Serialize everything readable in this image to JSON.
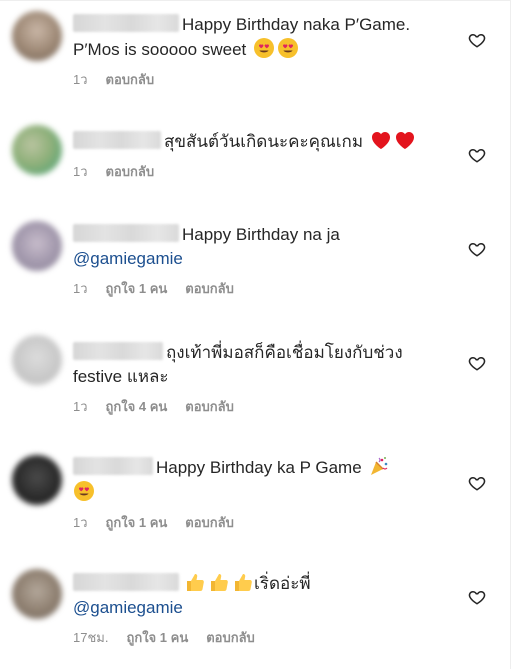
{
  "comments": [
    {
      "text": "Happy Birthday naka P′Game. P′Mos is sooooo sweet",
      "emoji": [
        "heart-eyes-face",
        "heart-eyes-face"
      ],
      "time": "1ว",
      "likes": "",
      "reply": "ตอบกลับ"
    },
    {
      "text": "สุขสันต์วันเกิดนะคะคุณเกม",
      "emoji": [
        "red-heart",
        "red-heart"
      ],
      "time": "1ว",
      "likes": "",
      "reply": "ตอบกลับ"
    },
    {
      "text": "Happy Birthday na ja",
      "mention": "@gamiegamie",
      "time": "1ว",
      "likes": "ถูกใจ 1 คน",
      "reply": "ตอบกลับ"
    },
    {
      "text": "ถุงเท้าพี่มอสก็คือเชื่อมโยงกับช่วง festive แหละ",
      "time": "1ว",
      "likes": "ถูกใจ 4 คน",
      "reply": "ตอบกลับ"
    },
    {
      "text": "Happy Birthday ka P Game",
      "emoji": [
        "party-popper",
        "heart-eyes-face"
      ],
      "time": "1ว",
      "likes": "ถูกใจ 1 คน",
      "reply": "ตอบกลับ"
    },
    {
      "emoji_before": [
        "thumbs-up",
        "thumbs-up",
        "thumbs-up"
      ],
      "text": "เริ่ดอ่ะพี่",
      "mention": "@gamiegamie",
      "time": "17ชม.",
      "likes": "ถูกใจ 1 คน",
      "reply": "ตอบกลับ"
    }
  ],
  "icons": {
    "like": "heart-outline-icon"
  },
  "colors": {
    "text": "#262626",
    "meta": "#8e8e8e",
    "mention": "#1c4f8f"
  }
}
